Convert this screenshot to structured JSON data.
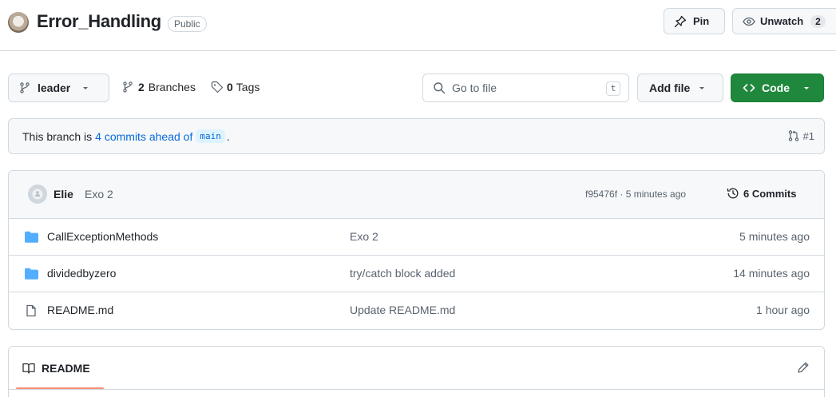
{
  "repo": {
    "name": "Error_Handling",
    "visibility": "Public"
  },
  "actions": {
    "pin_label": "Pin",
    "watch_label": "Unwatch",
    "watch_count": "2"
  },
  "toolbar": {
    "branch": "leader",
    "branches_count": "2",
    "branches_label": "Branches",
    "tags_count": "0",
    "tags_label": "Tags",
    "search_placeholder": "Go to file",
    "search_shortcut": "t",
    "add_file_label": "Add file",
    "code_label": "Code"
  },
  "ahead_banner": {
    "prefix": "This branch is",
    "link_text": "4 commits ahead of",
    "base_branch": "main",
    "suffix": ".",
    "pr_ref": "#1"
  },
  "latest_commit": {
    "author": "Elie",
    "message": "Exo 2",
    "meta": "f95476f · 5 minutes ago",
    "commits_label": "6 Commits"
  },
  "files": [
    {
      "name": "CallExceptionMethods",
      "type": "folder",
      "commit": "Exo 2",
      "time": "5 minutes ago"
    },
    {
      "name": "dividedbyzero",
      "type": "folder",
      "commit": "try/catch block added",
      "time": "14 minutes ago"
    },
    {
      "name": "README.md",
      "type": "file",
      "commit": "Update README.md",
      "time": "1 hour ago"
    }
  ],
  "readme": {
    "tab_label": "README"
  },
  "colors": {
    "accent_link": "#0969da",
    "primary_button": "#1f883d",
    "folder_icon": "#54aeff",
    "tab_underline": "#fd8c73"
  },
  "icons": {
    "pin": "pin-icon",
    "watch": "eye-icon",
    "branch": "git-branch-icon",
    "tag": "tag-icon",
    "search": "search-icon",
    "code": "code-icon",
    "pull_request": "git-pull-request-icon",
    "history": "history-icon",
    "folder": "folder-icon",
    "file": "file-icon",
    "book": "book-icon",
    "edit": "pencil-icon"
  }
}
